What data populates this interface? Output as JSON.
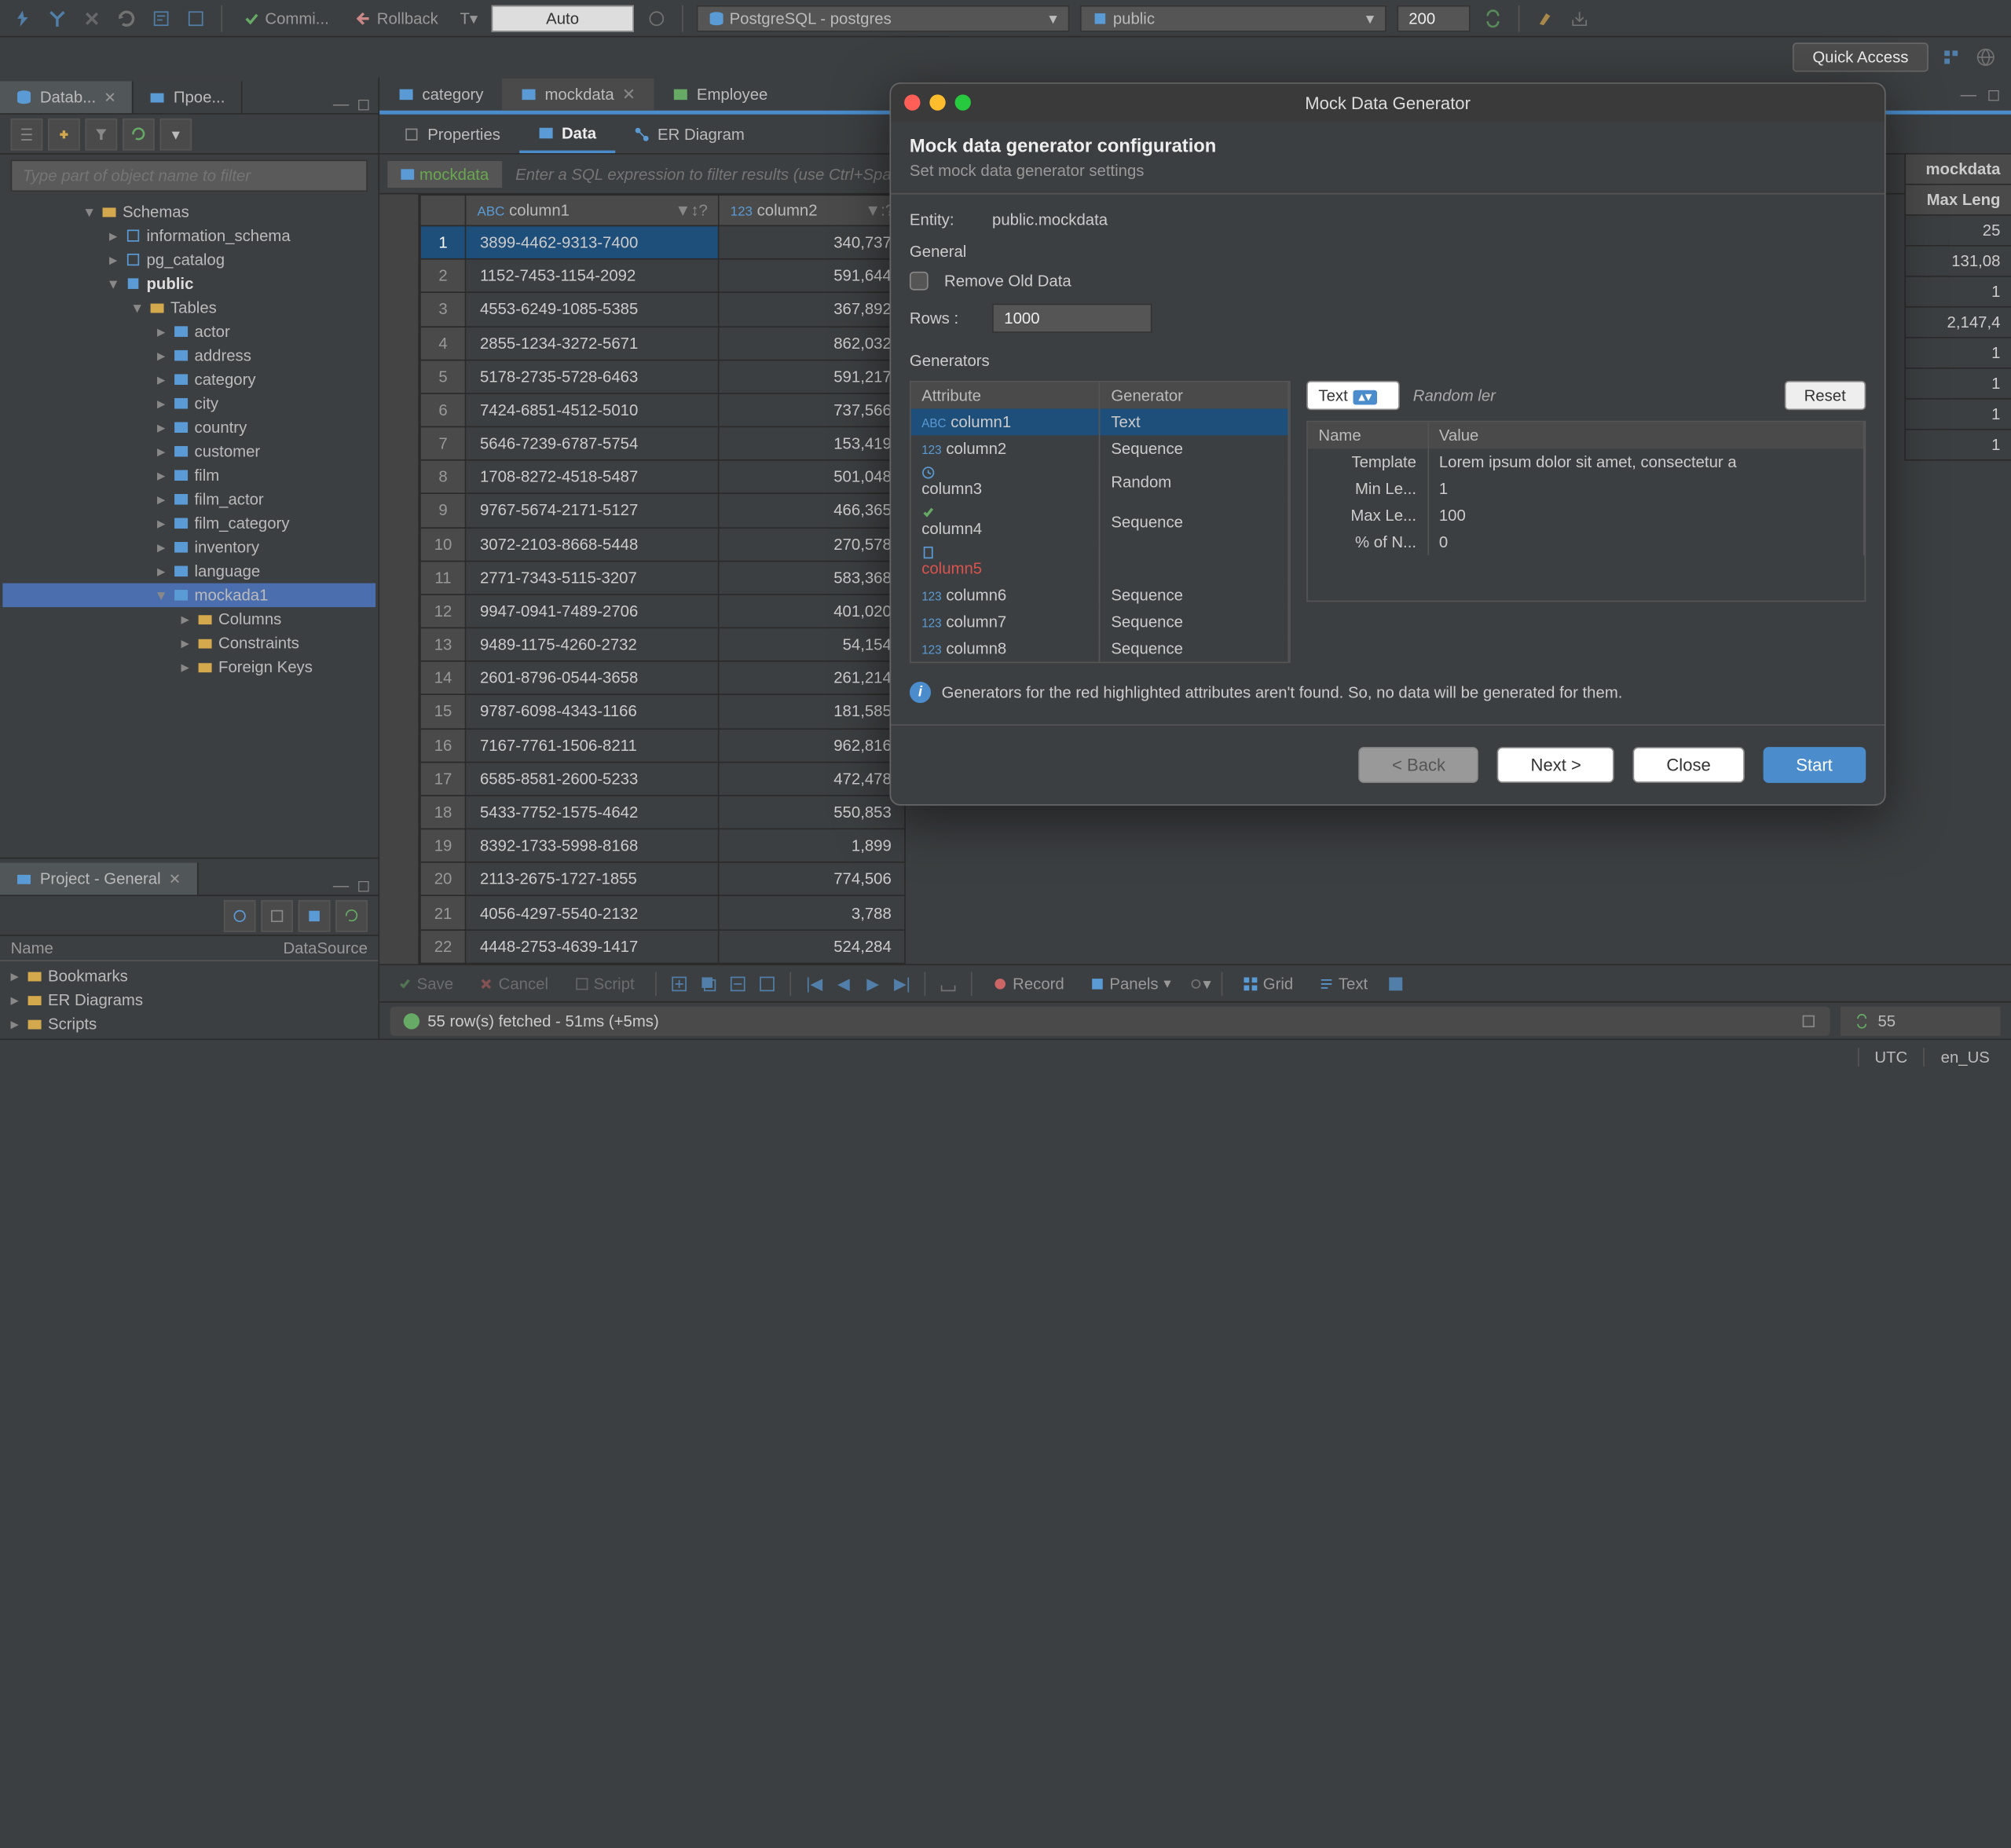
{
  "toolbar": {
    "commit": "Commi...",
    "rollback": "Rollback",
    "auto": "Auto",
    "connection": "PostgreSQL - postgres",
    "schema": "public",
    "fetch_size": "200"
  },
  "quick_access": "Quick Access",
  "left_tabs": {
    "database": "Datab...",
    "projects": "Прое..."
  },
  "tree_filter_placeholder": "Type part of object name to filter",
  "tree": {
    "schemas": "Schemas",
    "info_schema": "information_schema",
    "pg_catalog": "pg_catalog",
    "public": "public",
    "tables": "Tables",
    "items": [
      "actor",
      "address",
      "category",
      "city",
      "country",
      "customer",
      "film",
      "film_actor",
      "film_category",
      "inventory",
      "language",
      "mockada1"
    ],
    "sub": {
      "columns": "Columns",
      "constraints": "Constraints",
      "fk": "Foreign Keys"
    }
  },
  "project": {
    "title": "Project - General",
    "cols": {
      "name": "Name",
      "ds": "DataSource"
    },
    "items": [
      "Bookmarks",
      "ER Diagrams",
      "Scripts"
    ]
  },
  "editor_tabs": {
    "category": "category",
    "mockdata": "mockdata",
    "employee": "Employee"
  },
  "sub_tabs": {
    "properties": "Properties",
    "data": "Data",
    "er": "ER Diagram"
  },
  "filter": {
    "chip": "mockdata",
    "placeholder": "Enter a SQL expression to filter results (use Ctrl+Space)"
  },
  "grid": {
    "col1": "column1",
    "col2": "column2",
    "rows": [
      {
        "n": 1,
        "c1": "3899-4462-9313-7400",
        "c2": "340,737"
      },
      {
        "n": 2,
        "c1": "1152-7453-1154-2092",
        "c2": "591,644"
      },
      {
        "n": 3,
        "c1": "4553-6249-1085-5385",
        "c2": "367,892"
      },
      {
        "n": 4,
        "c1": "2855-1234-3272-5671",
        "c2": "862,032"
      },
      {
        "n": 5,
        "c1": "5178-2735-5728-6463",
        "c2": "591,217"
      },
      {
        "n": 6,
        "c1": "7424-6851-4512-5010",
        "c2": "737,566"
      },
      {
        "n": 7,
        "c1": "5646-7239-6787-5754",
        "c2": "153,419"
      },
      {
        "n": 8,
        "c1": "1708-8272-4518-5487",
        "c2": "501,048"
      },
      {
        "n": 9,
        "c1": "9767-5674-2171-5127",
        "c2": "466,365"
      },
      {
        "n": 10,
        "c1": "3072-2103-8668-5448",
        "c2": "270,578"
      },
      {
        "n": 11,
        "c1": "2771-7343-5115-3207",
        "c2": "583,368"
      },
      {
        "n": 12,
        "c1": "9947-0941-7489-2706",
        "c2": "401,020"
      },
      {
        "n": 13,
        "c1": "9489-1175-4260-2732",
        "c2": "54,154"
      },
      {
        "n": 14,
        "c1": "2601-8796-0544-3658",
        "c2": "261,214"
      },
      {
        "n": 15,
        "c1": "9787-6098-4343-1166",
        "c2": "181,585"
      },
      {
        "n": 16,
        "c1": "7167-7761-1506-8211",
        "c2": "962,816"
      },
      {
        "n": 17,
        "c1": "6585-8581-2600-5233",
        "c2": "472,478"
      },
      {
        "n": 18,
        "c1": "5433-7752-1575-4642",
        "c2": "550,853"
      },
      {
        "n": 19,
        "c1": "8392-1733-5998-8168",
        "c2": "1,899"
      },
      {
        "n": 20,
        "c1": "2113-2675-1727-1855",
        "c2": "774,506"
      },
      {
        "n": 21,
        "c1": "4056-4297-5540-2132",
        "c2": "3,788"
      },
      {
        "n": 22,
        "c1": "4448-2753-4639-1417",
        "c2": "524,284"
      }
    ]
  },
  "side_info": {
    "title": "mockdata",
    "max_len": "Max Leng",
    "rows": [
      "25",
      "131,08",
      "1",
      "2,147,4",
      "1",
      "1",
      "1",
      "1"
    ]
  },
  "bottom_tb": {
    "save": "Save",
    "cancel": "Cancel",
    "script": "Script",
    "record": "Record",
    "panels": "Panels",
    "grid": "Grid",
    "text": "Text"
  },
  "status": {
    "msg": "55 row(s) fetched - 51ms (+5ms)",
    "rows": "55"
  },
  "app_status": {
    "tz": "UTC",
    "locale": "en_US"
  },
  "dialog": {
    "title": "Mock Data Generator",
    "heading": "Mock data generator configuration",
    "subheading": "Set mock data generator settings",
    "entity_label": "Entity:",
    "entity_value": "public.mockdata",
    "general": "General",
    "remove_old": "Remove Old Data",
    "rows_label": "Rows :",
    "rows_value": "1000",
    "generators": "Generators",
    "attr_col": "Attribute",
    "gen_col": "Generator",
    "attrs": [
      {
        "name": "column1",
        "gen": "Text",
        "icon": "abc",
        "sel": true
      },
      {
        "name": "column2",
        "gen": "Sequence",
        "icon": "123"
      },
      {
        "name": "column3",
        "gen": "Random",
        "icon": "clock"
      },
      {
        "name": "column4",
        "gen": "Sequence",
        "icon": "check"
      },
      {
        "name": "column5",
        "gen": "",
        "icon": "doc",
        "err": true
      },
      {
        "name": "column6",
        "gen": "Sequence",
        "icon": "123"
      },
      {
        "name": "column7",
        "gen": "Sequence",
        "icon": "123"
      },
      {
        "name": "column8",
        "gen": "Sequence",
        "icon": "123"
      }
    ],
    "type_select": "Text",
    "type_hint": "Random ler",
    "reset": "Reset",
    "props_cols": {
      "name": "Name",
      "value": "Value"
    },
    "props": [
      {
        "n": "Template",
        "v": "Lorem ipsum dolor sit amet, consectetur a"
      },
      {
        "n": "Min Le...",
        "v": "1"
      },
      {
        "n": "Max Le...",
        "v": "100"
      },
      {
        "n": "% of N...",
        "v": "0"
      }
    ],
    "info": "Generators for the red highlighted attributes aren't found. So, no data will be generated for them.",
    "buttons": {
      "back": "< Back",
      "next": "Next >",
      "close": "Close",
      "start": "Start"
    }
  }
}
